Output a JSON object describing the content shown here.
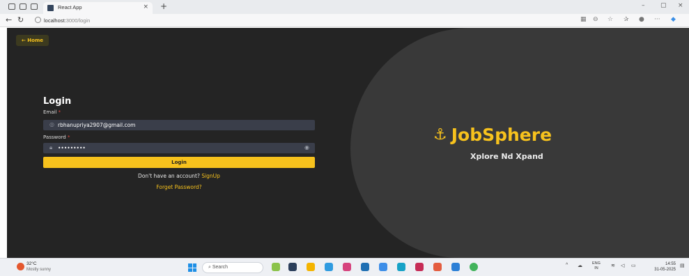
{
  "browser": {
    "tab_title": "React App",
    "tab_close": "×",
    "new_tab": "+",
    "url_host": "localhost:",
    "url_rest": "3000/login",
    "window_controls": {
      "minimize": "–",
      "maximize": "▢",
      "close": "×"
    }
  },
  "page": {
    "home_button": "← Home",
    "login_title": "Login",
    "email_label": "Email",
    "email_value": "rbhanupriya2907@gmail.com",
    "password_label": "Password",
    "password_value": "•••••••••",
    "required_mark": "*",
    "login_button": "Login",
    "no_account_text": "Don't have an account?",
    "signup_link": "SignUp",
    "forget_link": "Forget Password?",
    "brand_name": "JobSphere",
    "brand_icon": "⚓",
    "tagline": "Xplore Nd Xpand"
  },
  "taskbar": {
    "weather_temp": "32°C",
    "weather_desc": "Mostly sunny",
    "search_placeholder": "Search",
    "lang_1": "ENG",
    "lang_2": "IN",
    "time": "14:55",
    "date": "31-05-2025"
  },
  "colors": {
    "accent": "#f7c21d",
    "page_bg": "#242424",
    "panel_bg": "#393939",
    "input_bg": "#3a3e4a"
  }
}
